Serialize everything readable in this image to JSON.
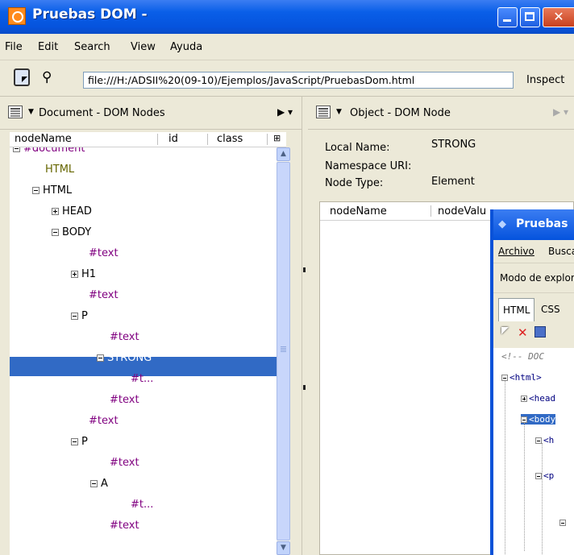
{
  "window": {
    "title": "Pruebas DOM -",
    "menu": [
      "File",
      "Edit",
      "Search",
      "View",
      "Ayuda"
    ],
    "url": "file:///H:/ADSII%20(09-10)/Ejemplos/JavaScript/PruebasDom.html",
    "inspect_label": "Inspect"
  },
  "left_panel": {
    "title": "Document - DOM Nodes",
    "columns": [
      "nodeName",
      "id",
      "class"
    ],
    "nodes": [
      {
        "label": "#document",
        "expander": "minus",
        "color": "purple"
      },
      {
        "label": "HTML",
        "expander": "",
        "color": "olive"
      },
      {
        "label": "HTML",
        "expander": "minus",
        "color": "black"
      },
      {
        "label": "HEAD",
        "expander": "plus",
        "color": "black"
      },
      {
        "label": "BODY",
        "expander": "minus",
        "color": "black"
      },
      {
        "label": "#text",
        "expander": "",
        "color": "purple"
      },
      {
        "label": "H1",
        "expander": "plus",
        "color": "black"
      },
      {
        "label": "#text",
        "expander": "",
        "color": "purple"
      },
      {
        "label": "P",
        "expander": "minus",
        "color": "black"
      },
      {
        "label": "#text",
        "expander": "",
        "color": "purple"
      },
      {
        "label": "STRONG",
        "expander": "minus",
        "color": "white",
        "selected": true
      },
      {
        "label": "#t...",
        "expander": "",
        "color": "purple"
      },
      {
        "label": "#text",
        "expander": "",
        "color": "purple"
      },
      {
        "label": "#text",
        "expander": "",
        "color": "purple"
      },
      {
        "label": "P",
        "expander": "minus",
        "color": "black"
      },
      {
        "label": "#text",
        "expander": "",
        "color": "purple"
      },
      {
        "label": "A",
        "expander": "minus",
        "color": "black"
      },
      {
        "label": "#t...",
        "expander": "",
        "color": "purple"
      },
      {
        "label": "#text",
        "expander": "",
        "color": "purple"
      }
    ]
  },
  "right_panel": {
    "title": "Object - DOM Node",
    "properties": [
      {
        "label": "Local Name:",
        "value": "STRONG"
      },
      {
        "label": "Namespace URI:",
        "value": ""
      },
      {
        "label": "Node Type:",
        "value": "Element"
      }
    ],
    "columns": [
      "nodeName",
      "nodeValu"
    ]
  },
  "overlay_window": {
    "title": "Pruebas",
    "menu": [
      "Archivo",
      "Busca"
    ],
    "mode_label": "Modo de explor",
    "tabs": [
      "HTML",
      "CSS"
    ],
    "tree": [
      {
        "text": "<!-- DOC",
        "comment": true
      },
      {
        "text": "<html>",
        "expander": "minus"
      },
      {
        "text": "<head",
        "expander": "plus"
      },
      {
        "text": "<body",
        "expander": "minus",
        "selected": true
      },
      {
        "text": "<h",
        "expander": "minus"
      },
      {
        "text": "<p",
        "expander": "minus"
      },
      {
        "text": "",
        "expander": "minus"
      }
    ]
  }
}
